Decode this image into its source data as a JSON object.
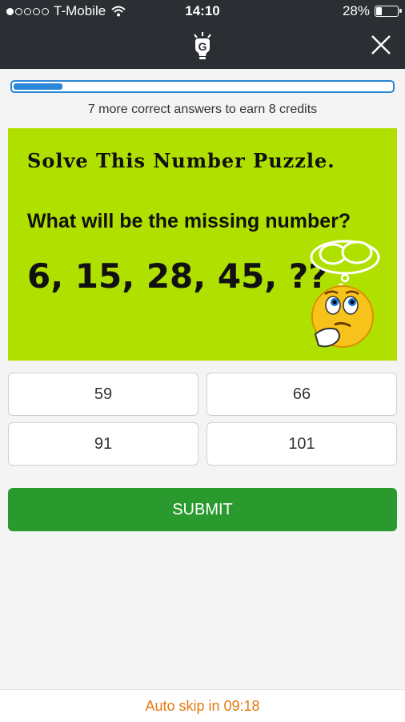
{
  "status_bar": {
    "carrier": "T-Mobile",
    "signal_strength": 1,
    "signal_max": 5,
    "time": "14:10",
    "battery_percent": "28%",
    "battery_level": 0.28
  },
  "header": {
    "logo_icon": "lightbulb-g-logo-icon",
    "close_icon": "close-icon"
  },
  "progress": {
    "fraction": 0.13,
    "text": "7 more correct answers to earn 8 credits",
    "color": "#2a86d6"
  },
  "puzzle": {
    "title": "Solve This Number Puzzle.",
    "question": "What will be the missing number?",
    "sequence": "6, 15, 28, 45, ??",
    "background_color": "#b0e000"
  },
  "answers": [
    {
      "label": "59"
    },
    {
      "label": "66"
    },
    {
      "label": "91"
    },
    {
      "label": "101"
    }
  ],
  "submit_label": "SUBMIT",
  "submit_color": "#2a9a2e",
  "footer": {
    "text": "Auto skip in 09:18",
    "color": "#e37b0f"
  }
}
